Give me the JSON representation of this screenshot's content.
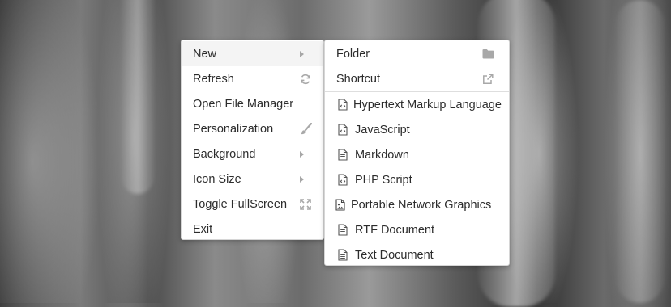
{
  "context_menu": {
    "items": [
      {
        "label": "New",
        "right": "chevron-right-icon"
      },
      {
        "label": "Refresh",
        "right": "refresh-icon"
      },
      {
        "label": "Open File Manager",
        "right": ""
      },
      {
        "label": "Personalization",
        "right": "paintbrush-icon"
      },
      {
        "label": "Background",
        "right": "chevron-right-icon"
      },
      {
        "label": "Icon Size",
        "right": "chevron-right-icon"
      },
      {
        "label": "Toggle FullScreen",
        "right": "fullscreen-icon"
      },
      {
        "label": "Exit",
        "right": ""
      }
    ]
  },
  "new_submenu": {
    "top_items": [
      {
        "label": "Folder",
        "icon": "folder-icon"
      },
      {
        "label": "Shortcut",
        "icon": "external-link-icon"
      }
    ],
    "file_items": [
      {
        "label": "Hypertext Markup Language",
        "icon": "code-file-icon"
      },
      {
        "label": "JavaScript",
        "icon": "code-file-icon"
      },
      {
        "label": "Markdown",
        "icon": "text-file-icon"
      },
      {
        "label": "PHP Script",
        "icon": "code-file-icon"
      },
      {
        "label": "Portable Network Graphics",
        "icon": "image-file-icon"
      },
      {
        "label": "RTF Document",
        "icon": "text-file-icon"
      },
      {
        "label": "Text Document",
        "icon": "text-file-icon"
      }
    ]
  },
  "colors": {
    "menu_bg": "#ffffff",
    "hover_bg": "#f4f4f4",
    "text": "#2c2c2c",
    "icon": "#9d9d9d"
  }
}
